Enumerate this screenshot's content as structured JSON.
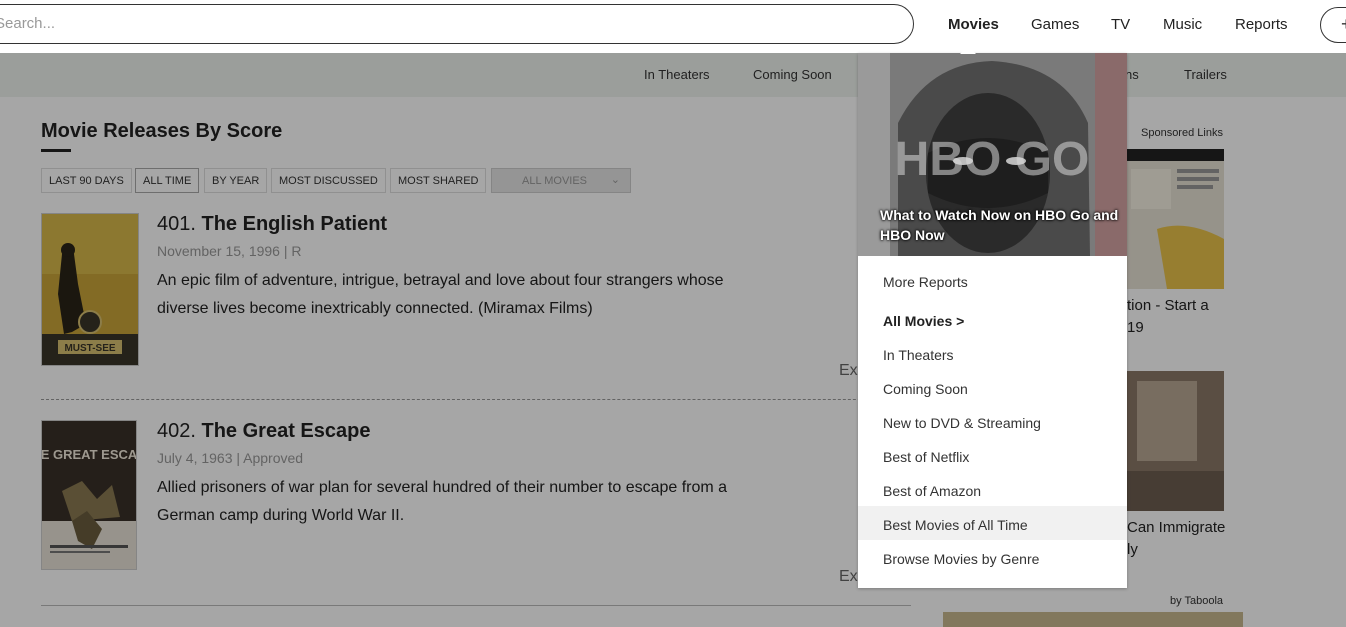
{
  "header": {
    "search_placeholder": "Search...",
    "nav": [
      "Movies",
      "Games",
      "TV",
      "Music",
      "Reports"
    ],
    "active_nav": "Movies",
    "plus_label": "+"
  },
  "subnav": [
    "In Theaters",
    "Coming Soon",
    "ns",
    "Trailers"
  ],
  "page": {
    "title": "Movie Releases By Score",
    "filters": [
      "LAST 90 DAYS",
      "ALL TIME",
      "BY YEAR",
      "MOST DISCUSSED",
      "MOST SHARED"
    ],
    "selected_filter": "ALL TIME",
    "select_value": "ALL MOVIES"
  },
  "movies": [
    {
      "number": "401.",
      "title": "The English Patient",
      "meta": "November 15, 1996 | R",
      "description": "An epic film of adventure, intrigue, betrayal and love about four strangers whose diverse lives become inextricably connected. (Miramax Films)",
      "expand": "Ex",
      "badge": "MUST-SEE"
    },
    {
      "number": "402.",
      "title": "The Great Escape",
      "meta": "July 4, 1963 | Approved",
      "description": "Allied prisoners of war plan for several hundred of their number to escape from a German camp during World War II.",
      "expand": "Ex",
      "poster_text": "THE GREAT ESCAPE"
    }
  ],
  "sidebar": {
    "sponsored": "Sponsored Links",
    "ad1_lines": [
      "tion - Start a",
      "19"
    ],
    "ad2_lines": [
      "Can Immigrate",
      "ly"
    ],
    "taboola": "by Taboola"
  },
  "dropdown": {
    "promo_text": "What to Watch Now on HBO Go and HBO Now",
    "promo_logo": "HBO GO",
    "items": [
      "More Reports",
      "All Movies >",
      "In Theaters",
      "Coming Soon",
      "New to DVD & Streaming",
      "Best of Netflix",
      "Best of Amazon",
      "Best Movies of All Time",
      "Browse Movies by Genre"
    ],
    "hovered_item": "Best Movies of All Time"
  }
}
